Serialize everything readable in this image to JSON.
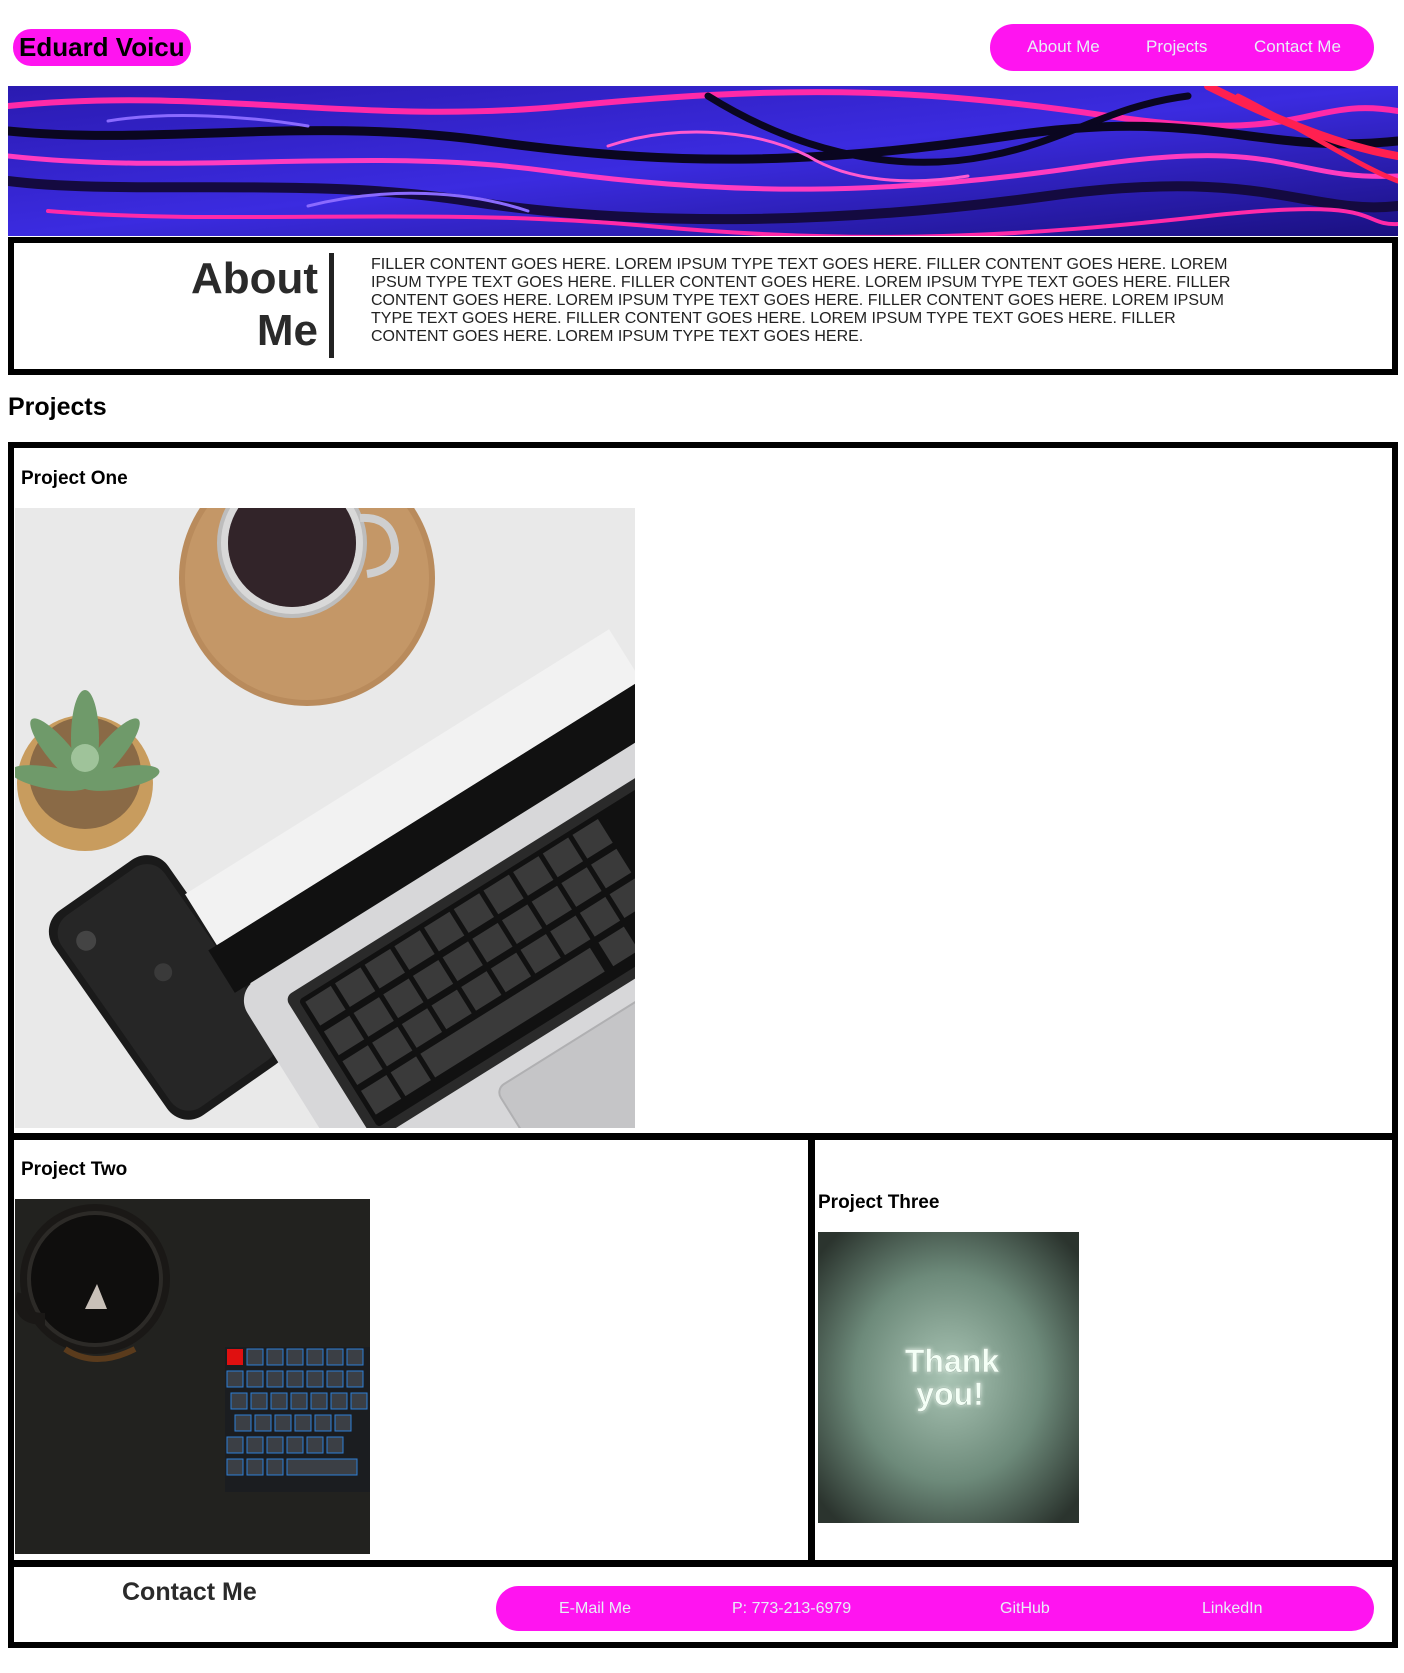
{
  "header": {
    "logo": "Eduard Voicu",
    "nav": [
      "About Me",
      "Projects",
      "Contact Me"
    ]
  },
  "about": {
    "title_line1": "About",
    "title_line2": "Me",
    "text": "FILLER CONTENT GOES HERE. LOREM IPSUM TYPE TEXT GOES HERE. FILLER CONTENT GOES HERE. LOREM IPSUM TYPE TEXT GOES HERE. FILLER CONTENT GOES HERE. LOREM IPSUM TYPE TEXT GOES HERE. FILLER CONTENT GOES HERE. LOREM IPSUM TYPE TEXT GOES HERE. FILLER CONTENT GOES HERE. LOREM IPSUM TYPE TEXT GOES HERE. FILLER CONTENT GOES HERE. LOREM IPSUM TYPE TEXT GOES HERE. FILLER CONTENT GOES HERE. LOREM IPSUM TYPE TEXT GOES HERE."
  },
  "projects": {
    "heading": "Projects",
    "items": [
      {
        "title": "Project One"
      },
      {
        "title": "Project Two"
      },
      {
        "title": "Project Three",
        "image_text_line1": "Thank",
        "image_text_line2": "you!"
      }
    ]
  },
  "contact": {
    "title": "Contact Me",
    "links": [
      "E-Mail Me",
      "P: 773-213-6979",
      "GitHub",
      "LinkedIn"
    ]
  },
  "colors": {
    "accent": "#ff14f0",
    "border": "#000000",
    "link_text": "#e8eef8"
  }
}
